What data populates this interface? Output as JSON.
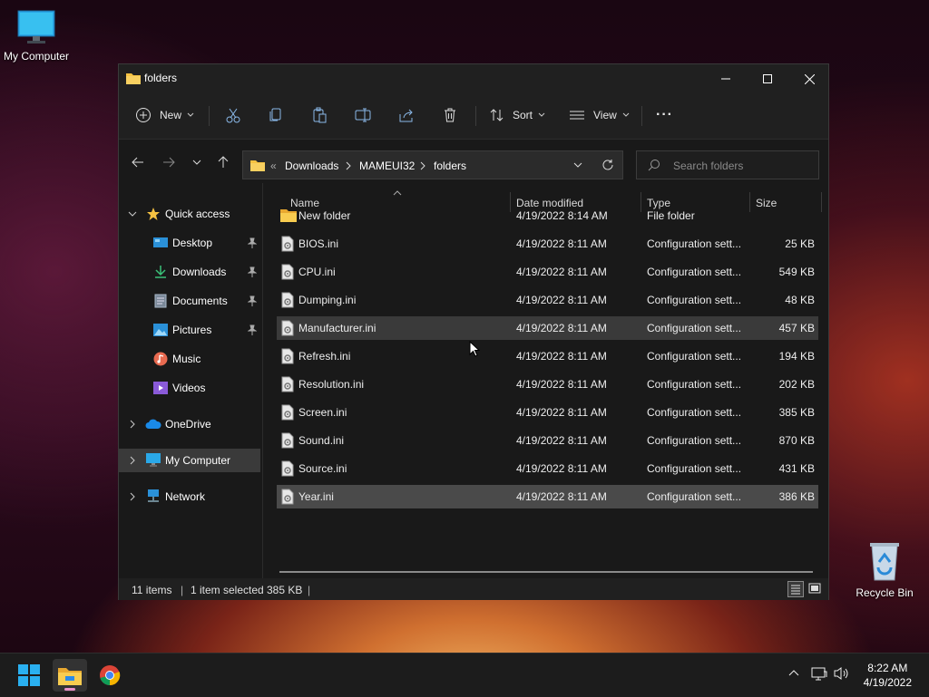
{
  "desktop": {
    "icons": [
      {
        "label": "My Computer"
      },
      {
        "label": "Recycle Bin"
      }
    ]
  },
  "window": {
    "title": "folders",
    "controls": {
      "minimize": "minimize",
      "maximize": "maximize",
      "close": "close"
    }
  },
  "toolbar": {
    "new_label": "New",
    "sort_label": "Sort",
    "view_label": "View",
    "more_label": "···"
  },
  "address": {
    "overflow": "«",
    "crumbs": [
      "Downloads",
      "MAMEUI32",
      "folders"
    ]
  },
  "search": {
    "placeholder": "Search folders"
  },
  "nav": {
    "quick_access": "Quick access",
    "items": [
      "Desktop",
      "Downloads",
      "Documents",
      "Pictures",
      "Music",
      "Videos"
    ],
    "onedrive": "OneDrive",
    "my_computer": "My Computer",
    "network": "Network"
  },
  "columns": {
    "name": "Name",
    "date": "Date modified",
    "type": "Type",
    "size": "Size"
  },
  "files": [
    {
      "name": "New folder",
      "date": "4/19/2022 8:14 AM",
      "type": "File folder",
      "size": ""
    },
    {
      "name": "BIOS.ini",
      "date": "4/19/2022 8:11 AM",
      "type": "Configuration sett...",
      "size": "25 KB"
    },
    {
      "name": "CPU.ini",
      "date": "4/19/2022 8:11 AM",
      "type": "Configuration sett...",
      "size": "549 KB"
    },
    {
      "name": "Dumping.ini",
      "date": "4/19/2022 8:11 AM",
      "type": "Configuration sett...",
      "size": "48 KB"
    },
    {
      "name": "Manufacturer.ini",
      "date": "4/19/2022 8:11 AM",
      "type": "Configuration sett...",
      "size": "457 KB"
    },
    {
      "name": "Refresh.ini",
      "date": "4/19/2022 8:11 AM",
      "type": "Configuration sett...",
      "size": "194 KB"
    },
    {
      "name": "Resolution.ini",
      "date": "4/19/2022 8:11 AM",
      "type": "Configuration sett...",
      "size": "202 KB"
    },
    {
      "name": "Screen.ini",
      "date": "4/19/2022 8:11 AM",
      "type": "Configuration sett...",
      "size": "385 KB"
    },
    {
      "name": "Sound.ini",
      "date": "4/19/2022 8:11 AM",
      "type": "Configuration sett...",
      "size": "870 KB"
    },
    {
      "name": "Source.ini",
      "date": "4/19/2022 8:11 AM",
      "type": "Configuration sett...",
      "size": "431 KB"
    },
    {
      "name": "Year.ini",
      "date": "4/19/2022 8:11 AM",
      "type": "Configuration sett...",
      "size": "386 KB"
    }
  ],
  "status": {
    "items": "11 items",
    "selected": "1 item selected",
    "selected_size": "385 KB"
  },
  "taskbar": {
    "time": "8:22 AM",
    "date": "4/19/2022"
  },
  "colors": {
    "window_bg": "#202020",
    "pane_bg": "#191919",
    "selected_row": "#4a4a4a",
    "hover_row": "#3a3a3a",
    "folder_yellow": "#f5c242",
    "accent_blue": "#3aa0e8"
  }
}
